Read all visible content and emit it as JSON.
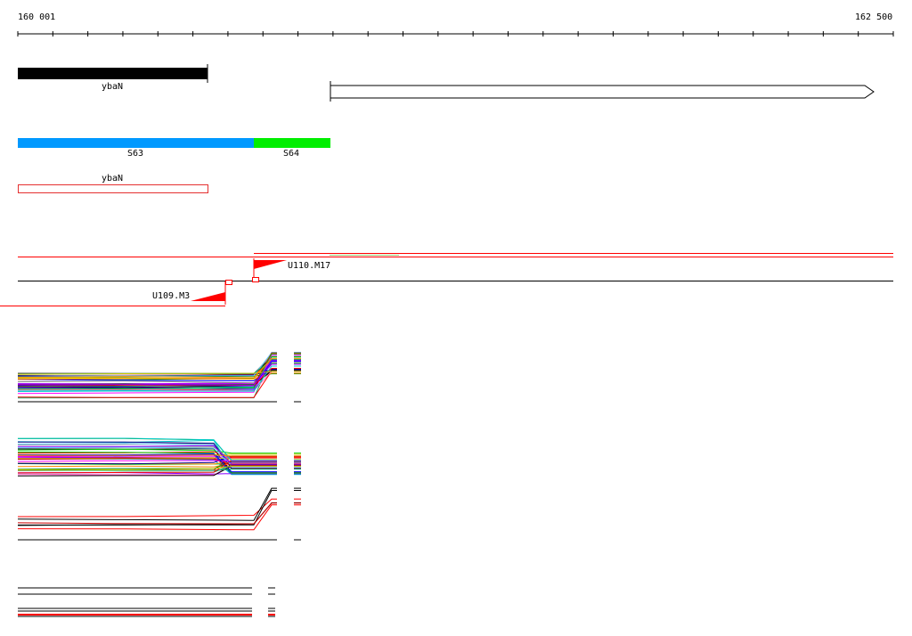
{
  "ruler": {
    "start_label": "160 001",
    "end_label": "162 500",
    "tick_count": 25
  },
  "genes": {
    "gene_a_label": "ybaN",
    "fragment_a_label": "S63",
    "fragment_b_label": "S64",
    "annotation_label": "ybaN"
  },
  "probes": {
    "probe_upper_label": "U110.M17",
    "probe_lower_label": "U109.M3"
  },
  "colors": {
    "fragment_a": "#0099ff",
    "fragment_b": "#00ee00",
    "probe": "#ff0000",
    "gene_fill": "#000000"
  }
}
